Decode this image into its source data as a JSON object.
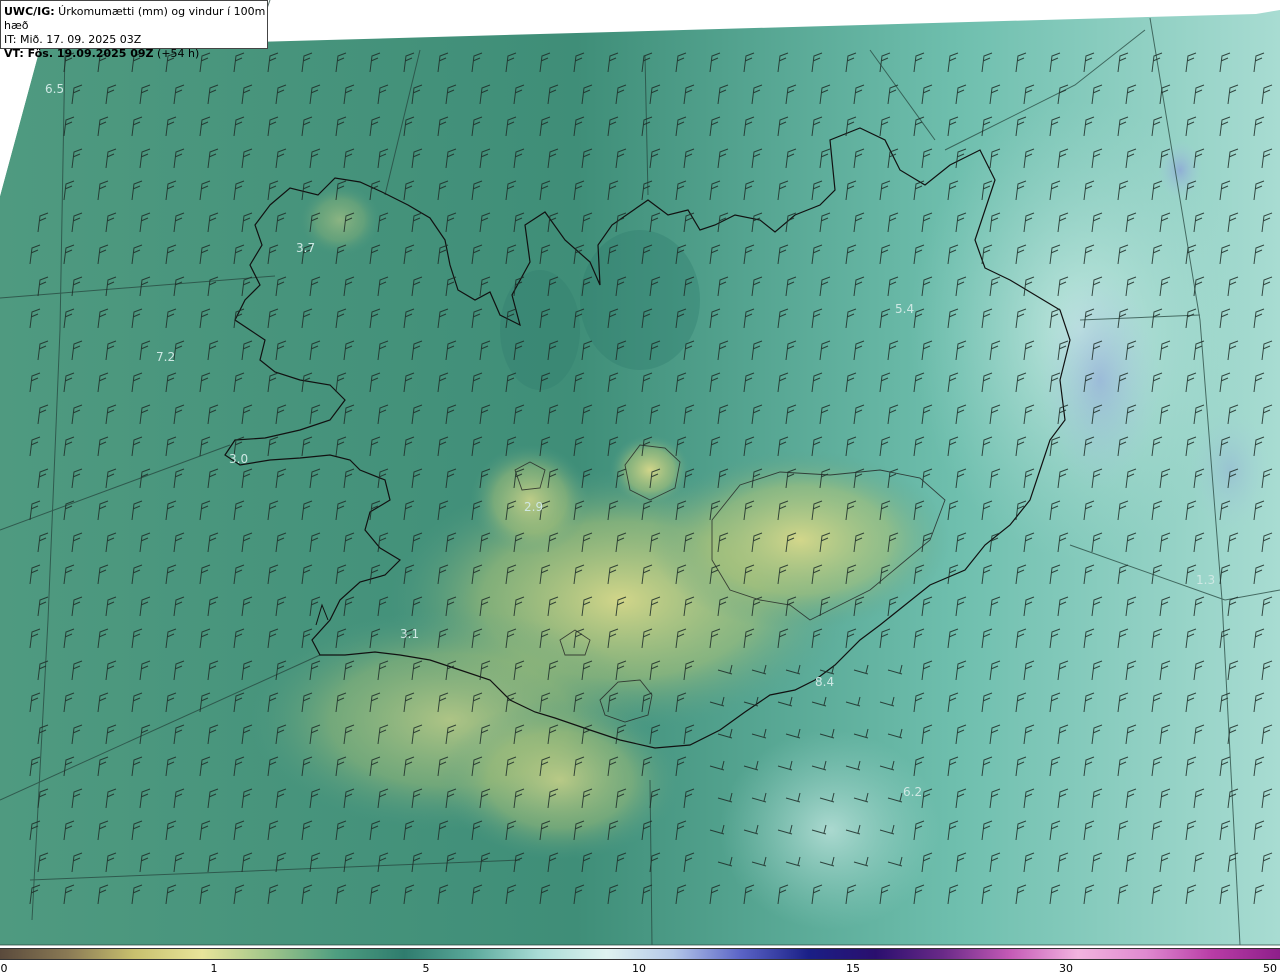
{
  "header": {
    "title_bold": "UWC/IG:",
    "title_rest": " Úrkomumætti (mm) og vindur í 100m hæð",
    "init_time": "IT: Mið. 17. 09. 2025 03Z",
    "valid_prefix": "VT: Fös. 19.09.2025 09Z",
    "valid_suffix": " (+54 h)"
  },
  "map_labels": [
    {
      "text": "6.5"
    },
    {
      "text": "3.7"
    },
    {
      "text": "7.2"
    },
    {
      "text": "3.0"
    },
    {
      "text": "2.9"
    },
    {
      "text": "3.1"
    },
    {
      "text": "5.4"
    },
    {
      "text": "8.4"
    },
    {
      "text": "6.2"
    },
    {
      "text": "1.3"
    }
  ],
  "colorbar": {
    "ticks": [
      "0",
      "1",
      "5",
      "10",
      "15",
      "30",
      "50"
    ],
    "colors": [
      "#5a4a3c",
      "#8a7a55",
      "#c8c06e",
      "#e8e59a",
      "#9fc48a",
      "#4e9e80",
      "#2f7c6e",
      "#5aa89a",
      "#a9dcd6",
      "#dff3f0",
      "#b4c7e8",
      "#5a63c6",
      "#1a1f86",
      "#2a0f6e",
      "#6a2a88",
      "#c45ab6",
      "#f2b4df",
      "#e08ad0",
      "#b83ca6",
      "#8e1f8a"
    ]
  }
}
